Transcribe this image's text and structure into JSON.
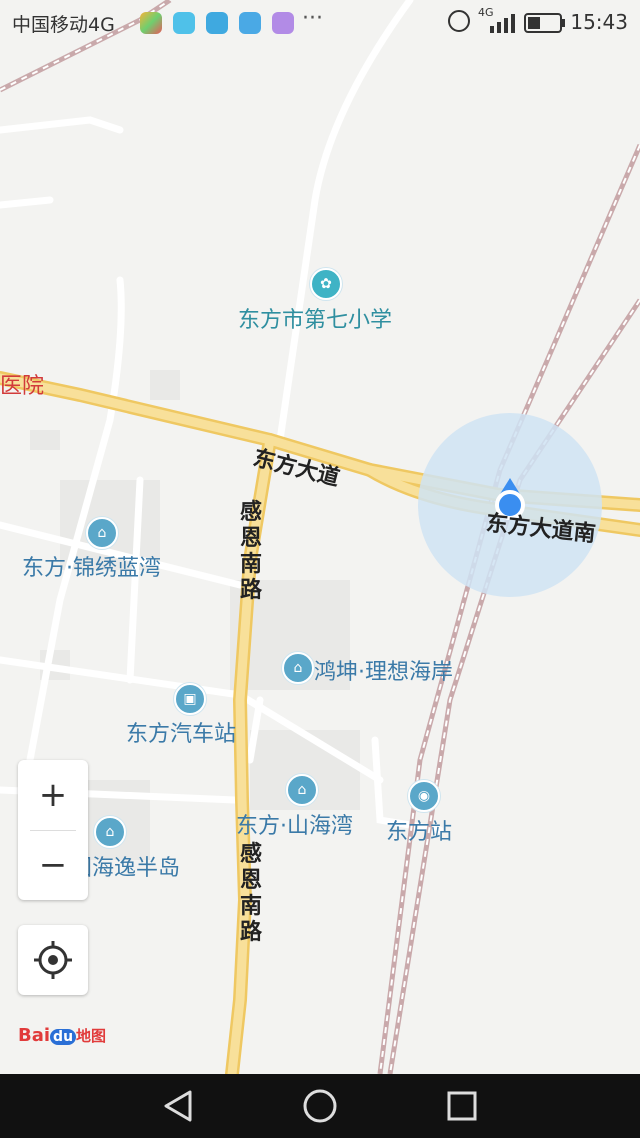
{
  "status_bar": {
    "carrier": "中国移动4G",
    "time": "15:43",
    "network": "4G",
    "more": "···"
  },
  "map": {
    "labels": {
      "school": "东方市第七小学",
      "hospital": "医院",
      "dongfang_avenue": "东方大道",
      "dongfang_avenue_south": "东方大道南",
      "ganen_south_road_1": "感恩南路",
      "ganen_south_road_2": "感恩南路",
      "jinxiu_lanwan": "东方·锦绣蓝湾",
      "hongkun": "鸿坤·理想海岸",
      "bus_station": "东方汽车站",
      "shanhaiwan": "东方·山海湾",
      "train_station": "东方站",
      "bandao": "国海逸半岛"
    },
    "colors": {
      "background": "#f3f3f1",
      "main_road": "#f6d67a",
      "minor_road": "#ffffff",
      "railway": "#c9a9ab",
      "location_dot": "#3a8ef0",
      "accuracy_circle": "#cfe3f3"
    }
  },
  "controls": {
    "zoom_in": "+",
    "zoom_out": "−",
    "logo_text": "Bai",
    "logo_du": "du",
    "logo_map": "地图"
  }
}
